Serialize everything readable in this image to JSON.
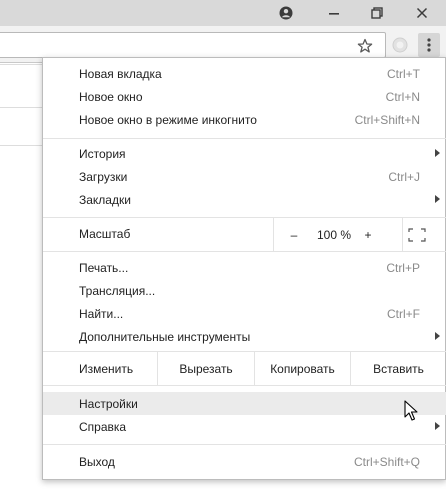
{
  "window": {
    "icons": [
      "profile-icon",
      "minimize-icon",
      "maximize-icon",
      "close-icon"
    ]
  },
  "toolbar": {
    "icons": [
      "bookmark-star-icon",
      "extension-icon",
      "chrome-menu-icon"
    ]
  },
  "menu": {
    "new_tab": {
      "label": "Новая вкладка",
      "shortcut": "Ctrl+T"
    },
    "new_window": {
      "label": "Новое окно",
      "shortcut": "Ctrl+N"
    },
    "incognito": {
      "label": "Новое окно в режиме инкогнито",
      "shortcut": "Ctrl+Shift+N"
    },
    "history": {
      "label": "История"
    },
    "downloads": {
      "label": "Загрузки",
      "shortcut": "Ctrl+J"
    },
    "bookmarks": {
      "label": "Закладки"
    },
    "zoom": {
      "label": "Масштаб",
      "minus": "–",
      "value": "100 %",
      "plus": "+"
    },
    "print": {
      "label": "Печать...",
      "shortcut": "Ctrl+P"
    },
    "cast": {
      "label": "Трансляция..."
    },
    "find": {
      "label": "Найти...",
      "shortcut": "Ctrl+F"
    },
    "more_tools": {
      "label": "Дополнительные инструменты"
    },
    "edit": {
      "label": "Изменить",
      "cut": "Вырезать",
      "copy": "Копировать",
      "paste": "Вставить"
    },
    "settings": {
      "label": "Настройки"
    },
    "help": {
      "label": "Справка"
    },
    "exit": {
      "label": "Выход",
      "shortcut": "Ctrl+Shift+Q"
    }
  },
  "colors": {
    "titlebar": "#d9d9d9",
    "toolbar": "#f2f2f2",
    "highlight": "#ebebeb",
    "shortcut_text": "#8a8a8a"
  }
}
